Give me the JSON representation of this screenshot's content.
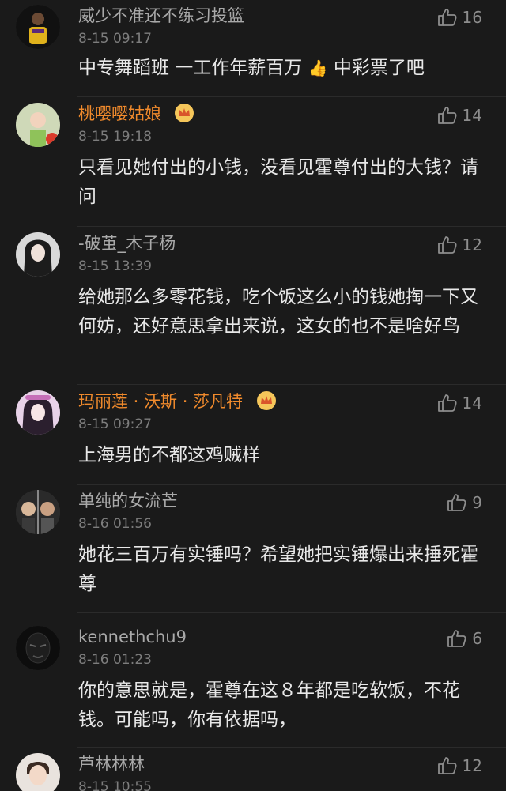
{
  "comments": [
    {
      "username": "威少不准还不练习投篮",
      "time": "8-15 09:17",
      "text": "中专舞蹈班 一工作年薪百万",
      "text_emoji": "👍",
      "text_tail": " 中彩票了吧",
      "likes": "16",
      "vip": false
    },
    {
      "username": "桃嘤嘤姑娘",
      "time": "8-15 19:18",
      "text": "只看见她付出的小钱，没看见霍尊付出的大钱？请问",
      "likes": "14",
      "vip": true
    },
    {
      "username": "-破茧_木子杨",
      "time": "8-15 13:39",
      "text": "给她那么多零花钱，吃个饭这么小的钱她掏一下又何妨，还好意思拿出来说，这女的也不是啥好鸟",
      "likes": "12",
      "vip": false
    },
    {
      "username": "玛丽莲 · 沃斯 · 莎凡特",
      "time": "8-15 09:27",
      "text": "上海男的不都这鸡贼样",
      "likes": "14",
      "vip": true
    },
    {
      "username": "单纯的女流芒",
      "time": "8-16 01:56",
      "text": "她花三百万有实锤吗？希望她把实锤爆出来捶死霍尊",
      "likes": "9",
      "vip": false
    },
    {
      "username": "kennethchu9",
      "time": "8-16 01:23",
      "text": "你的意思就是，霍尊在这８年都是吃软饭，不花钱。可能吗，你有依据吗，",
      "likes": "6",
      "vip": false
    },
    {
      "username": "芦林林林",
      "time": "8-15 10:55",
      "text": "",
      "likes": "12",
      "vip": false
    }
  ],
  "icons": {
    "like": "thumbs-up-icon",
    "crown": "crown-icon"
  },
  "colors": {
    "background": "#1a1a1a",
    "vip_name": "#f08a2c",
    "username": "#a9a9a9",
    "time": "#7d7d7d"
  }
}
